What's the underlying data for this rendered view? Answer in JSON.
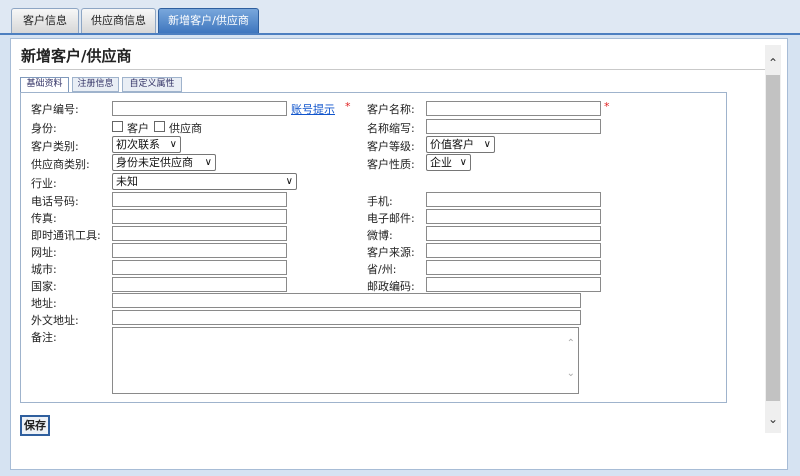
{
  "tabs": [
    {
      "label": "客户信息",
      "active": false
    },
    {
      "label": "供应商信息",
      "active": false
    },
    {
      "label": "新增客户/供应商",
      "active": true
    }
  ],
  "page_title": "新增客户/供应商",
  "sub_tabs": [
    {
      "label": "基础资料",
      "active": true
    },
    {
      "label": "注册信息",
      "active": false
    },
    {
      "label": "自定义属性",
      "active": false
    }
  ],
  "form": {
    "customer_no": {
      "label": "客户编号:",
      "value": "",
      "link": "账号提示",
      "required": "*"
    },
    "customer_name": {
      "label": "客户名称:",
      "value": "",
      "required": "*"
    },
    "identity": {
      "label": "身份:",
      "opt_customer": "客户",
      "opt_supplier": "供应商"
    },
    "short_name": {
      "label": "名称缩写:",
      "value": ""
    },
    "customer_type": {
      "label": "客户类别:",
      "value": "初次联系"
    },
    "customer_level": {
      "label": "客户等级:",
      "value": "价值客户"
    },
    "supplier_type": {
      "label": "供应商类别:",
      "value": "身份未定供应商"
    },
    "customer_nature": {
      "label": "客户性质:",
      "value": "企业"
    },
    "industry": {
      "label": "行业:",
      "value": "未知"
    },
    "phone": {
      "label": "电话号码:",
      "value": ""
    },
    "mobile": {
      "label": "手机:",
      "value": ""
    },
    "fax": {
      "label": "传真:",
      "value": ""
    },
    "email": {
      "label": "电子邮件:",
      "value": ""
    },
    "im": {
      "label": "即时通讯工具:",
      "value": ""
    },
    "weibo": {
      "label": "微博:",
      "value": ""
    },
    "website": {
      "label": "网址:",
      "value": ""
    },
    "source": {
      "label": "客户来源:",
      "value": ""
    },
    "city": {
      "label": "城市:",
      "value": ""
    },
    "province": {
      "label": "省/州:",
      "value": ""
    },
    "country": {
      "label": "国家:",
      "value": ""
    },
    "zip": {
      "label": "邮政编码:",
      "value": ""
    },
    "address": {
      "label": "地址:",
      "value": ""
    },
    "foreign_address": {
      "label": "外文地址:",
      "value": ""
    },
    "remark": {
      "label": "备注:",
      "value": ""
    }
  },
  "save_label": "保存",
  "colors": {
    "accent": "#3c74bd",
    "required": "#e02020",
    "link": "#1155cc"
  }
}
